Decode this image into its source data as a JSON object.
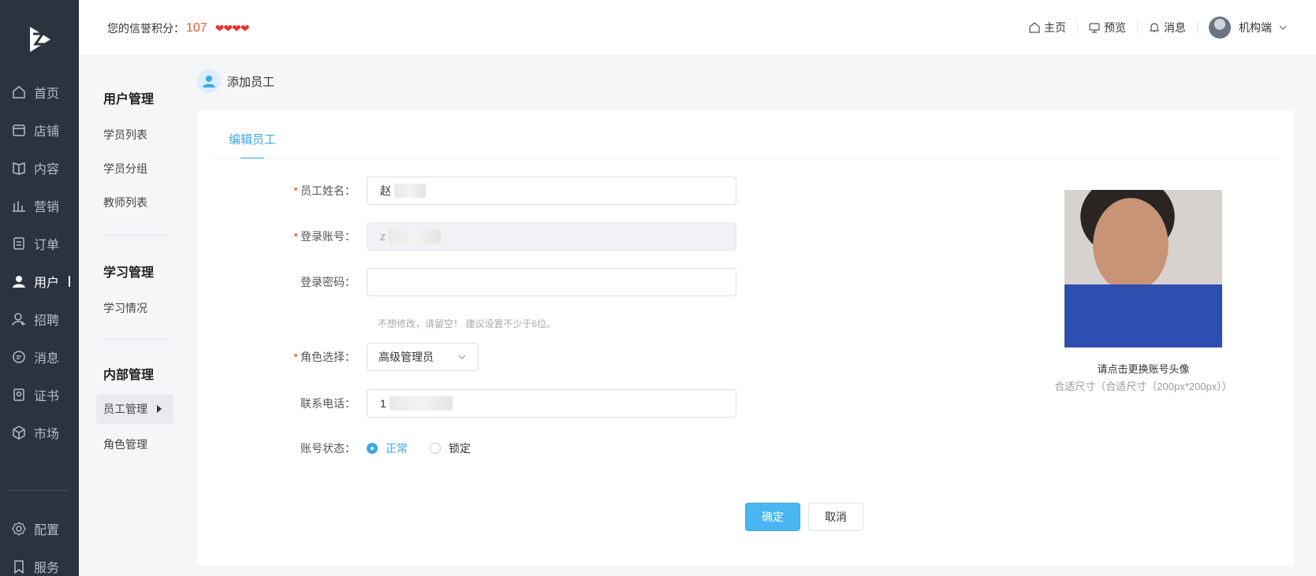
{
  "header": {
    "credit_label": "您的信誉积分：",
    "credit_score": "107",
    "hearts": "❤❤❤❤",
    "links": [
      {
        "label": "主页",
        "icon": "home-icon"
      },
      {
        "label": "预览",
        "icon": "monitor-icon"
      },
      {
        "label": "消息",
        "icon": "bell-icon"
      }
    ],
    "user_label": "机构端"
  },
  "nav": {
    "items": [
      {
        "label": "首页",
        "icon": "home-icon"
      },
      {
        "label": "店铺",
        "icon": "store-icon"
      },
      {
        "label": "内容",
        "icon": "book-icon"
      },
      {
        "label": "营销",
        "icon": "chart-icon"
      },
      {
        "label": "订单",
        "icon": "order-icon"
      },
      {
        "label": "用户",
        "icon": "user-icon",
        "active": true
      },
      {
        "label": "招聘",
        "icon": "recruit-icon"
      },
      {
        "label": "消息",
        "icon": "chat-icon"
      },
      {
        "label": "证书",
        "icon": "certificate-icon"
      },
      {
        "label": "市场",
        "icon": "cube-icon"
      },
      {
        "label": "配置",
        "icon": "settings-icon"
      },
      {
        "label": "服务",
        "icon": "service-icon"
      }
    ]
  },
  "subnav": {
    "groups": [
      {
        "title": "用户管理",
        "items": [
          "学员列表",
          "学员分组",
          "教师列表"
        ]
      },
      {
        "title": "学习管理",
        "items": [
          "学习情况"
        ]
      },
      {
        "title": "内部管理",
        "items": [
          "员工管理",
          "角色管理"
        ],
        "active": "员工管理"
      }
    ]
  },
  "page": {
    "title": "添加员工",
    "tab": "编辑员工"
  },
  "form": {
    "name_label": "员工姓名：",
    "name_value": "赵",
    "account_label": "登录账号：",
    "account_value": "z",
    "password_label": "登录密码：",
    "password_hint": "不想修改，请留空！ 建议设置不少于6位。",
    "role_label": "角色选择：",
    "role_value": "高级管理员",
    "phone_label": "联系电话：",
    "phone_value": "1",
    "status_label": "账号状态：",
    "status_options": [
      "正常",
      "锁定"
    ],
    "status_selected": "正常",
    "submit": "确定",
    "cancel": "取消"
  },
  "uploader": {
    "caption": "请点击更换账号头像",
    "size_hint": "合适尺寸（合适尺寸（200px*200px））"
  },
  "colors": {
    "nav_bg": "#2b3240",
    "accent": "#3ba7e8",
    "primary_button": "#4ab5f2",
    "required": "#e8332e"
  }
}
